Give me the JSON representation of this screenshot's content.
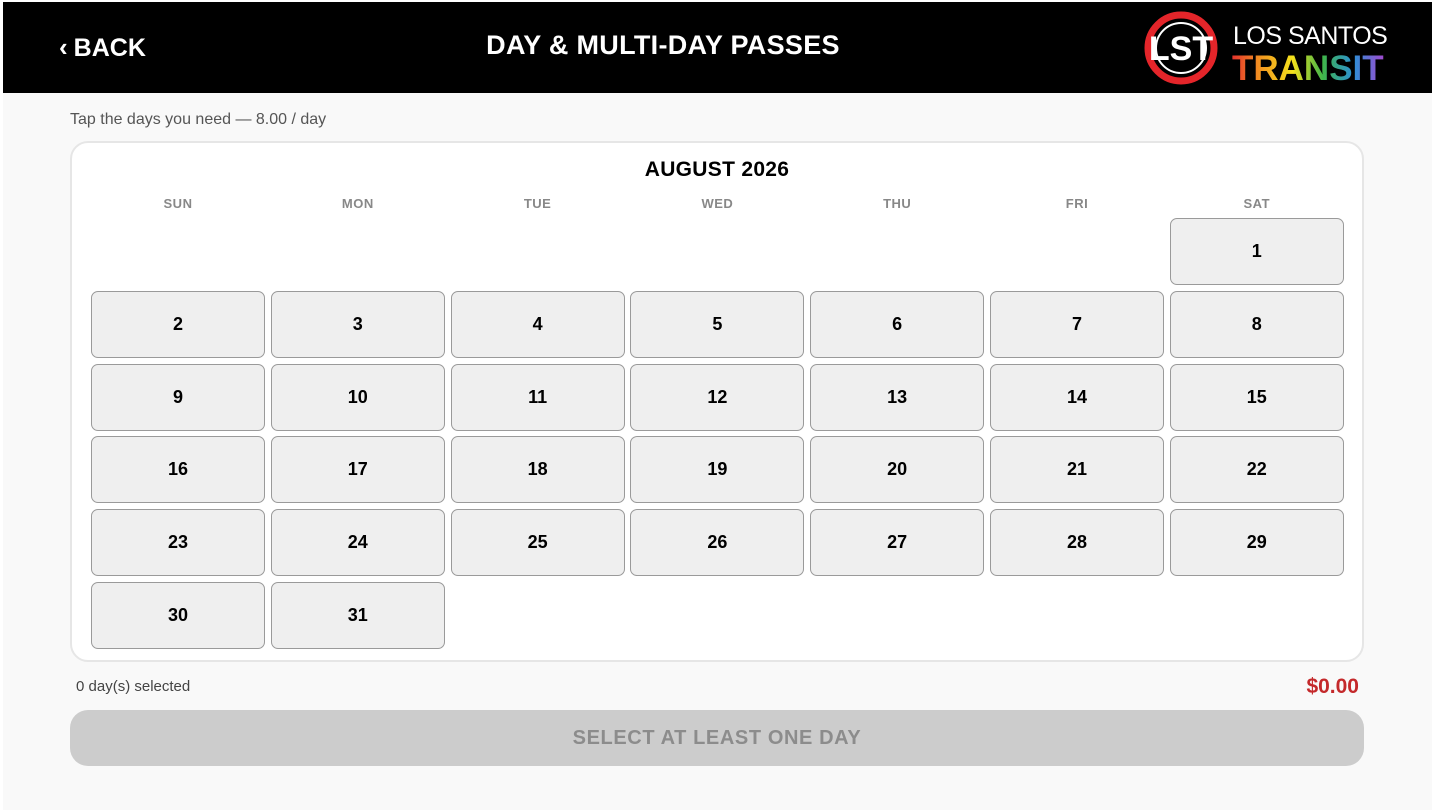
{
  "header": {
    "back_label": "BACK",
    "title": "DAY & MULTI-DAY PASSES",
    "logo_mark": "LST",
    "logo_top": "LOS SANTOS",
    "logo_bottom": "TRANSIT"
  },
  "subtitle": "Tap the days you need — 8.00 / day",
  "calendar": {
    "month_title": "AUGUST 2026",
    "weekdays": [
      "SUN",
      "MON",
      "TUE",
      "WED",
      "THU",
      "FRI",
      "SAT"
    ],
    "first_weekday_index": 6,
    "days": [
      "1",
      "2",
      "3",
      "4",
      "5",
      "6",
      "7",
      "8",
      "9",
      "10",
      "11",
      "12",
      "13",
      "14",
      "15",
      "16",
      "17",
      "18",
      "19",
      "20",
      "21",
      "22",
      "23",
      "24",
      "25",
      "26",
      "27",
      "28",
      "29",
      "30",
      "31"
    ]
  },
  "summary": {
    "selected_text": "0 day(s) selected",
    "total": "$0.00"
  },
  "cta": {
    "label": "SELECT AT LEAST ONE DAY"
  },
  "colors": {
    "header_bg": "#000000",
    "total_red": "#c4292b",
    "day_bg": "#efefef",
    "cta_disabled_bg": "#cccccc"
  }
}
